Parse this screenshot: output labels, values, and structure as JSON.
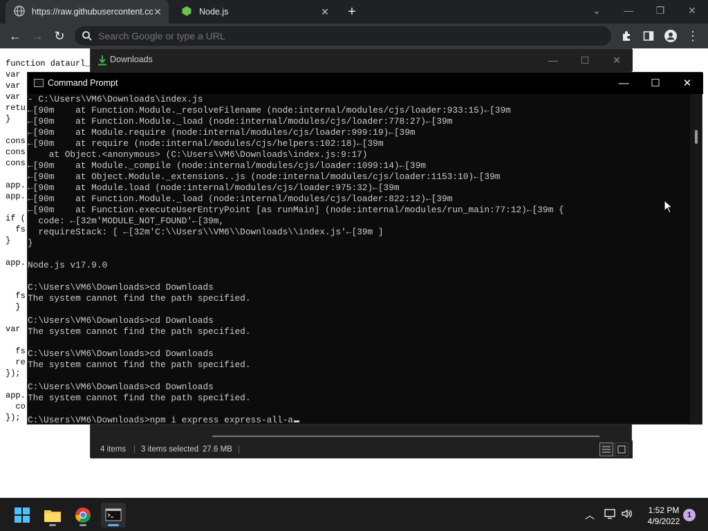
{
  "browser": {
    "tabs": [
      {
        "title": "https://raw.githubusercontent.co",
        "icon": "globe-icon"
      },
      {
        "title": "Node.js",
        "icon": "nodejs-icon"
      }
    ],
    "omnibox": {
      "placeholder": "Search Google or type a URL"
    },
    "page_code": [
      "function dataurl_",
      "var ",
      "var ",
      "var ",
      "retu",
      "}",
      "",
      "cons",
      "cons",
      "cons",
      "",
      "app.",
      "app.",
      "",
      "if (",
      "  fs",
      "}",
      "",
      "app.",
      "",
      "",
      "  fs",
      "  }",
      "",
      "var ",
      "",
      "  fs",
      "  re",
      "});",
      "",
      "app.",
      "  co",
      "});"
    ]
  },
  "downloads_window": {
    "title": "Downloads",
    "status": {
      "items": "4 items",
      "selected": "3 items selected",
      "size": "27.6 MB"
    }
  },
  "cmd_window": {
    "title": "Command Prompt",
    "lines": [
      "- C:\\Users\\VM6\\Downloads\\index.js",
      "←[90m    at Function.Module._resolveFilename (node:internal/modules/cjs/loader:933:15)←[39m",
      "←[90m    at Function.Module._load (node:internal/modules/cjs/loader:778:27)←[39m",
      "←[90m    at Module.require (node:internal/modules/cjs/loader:999:19)←[39m",
      "←[90m    at require (node:internal/modules/cjs/helpers:102:18)←[39m",
      "    at Object.<anonymous> (C:\\Users\\VM6\\Downloads\\index.js:9:17)",
      "←[90m    at Module._compile (node:internal/modules/cjs/loader:1099:14)←[39m",
      "←[90m    at Object.Module._extensions..js (node:internal/modules/cjs/loader:1153:10)←[39m",
      "←[90m    at Module.load (node:internal/modules/cjs/loader:975:32)←[39m",
      "←[90m    at Function.Module._load (node:internal/modules/cjs/loader:822:12)←[39m",
      "←[90m    at Function.executeUserEntryPoint [as runMain] (node:internal/modules/run_main:77:12)←[39m {",
      "  code: ←[32m'MODULE_NOT_FOUND'←[39m,",
      "  requireStack: [ ←[32m'C:\\\\Users\\\\VM6\\\\Downloads\\\\index.js'←[39m ]",
      "}",
      "",
      "Node.js v17.9.0",
      "",
      "C:\\Users\\VM6\\Downloads>cd Downloads",
      "The system cannot find the path specified.",
      "",
      "C:\\Users\\VM6\\Downloads>cd Downloads",
      "The system cannot find the path specified.",
      "",
      "C:\\Users\\VM6\\Downloads>cd Downloads",
      "The system cannot find the path specified.",
      "",
      "C:\\Users\\VM6\\Downloads>cd Downloads",
      "The system cannot find the path specified.",
      "",
      "C:\\Users\\VM6\\Downloads>npm i express express-all-a"
    ]
  },
  "taskbar": {
    "apps": [
      "start-icon",
      "file-explorer-icon",
      "chrome-icon",
      "command-prompt-icon"
    ],
    "clock": {
      "time": "1:52 PM",
      "date": "4/9/2022"
    },
    "notification_count": "1"
  },
  "colors": {
    "terminal_bg": "#0c0c0c",
    "terminal_fg": "#cccccc",
    "accent": "#5fb2f2"
  }
}
